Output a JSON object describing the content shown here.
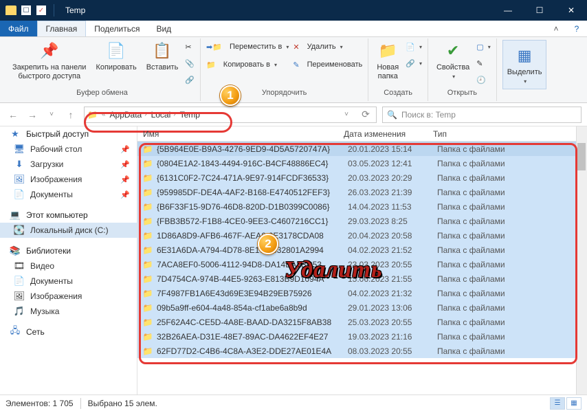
{
  "titlebar": {
    "title": "Temp"
  },
  "menu": {
    "file": "Файл",
    "main": "Главная",
    "share": "Поделиться",
    "view": "Вид"
  },
  "ribbon": {
    "pin": "Закрепить на панели\nбыстрого доступа",
    "copy": "Копировать",
    "paste": "Вставить",
    "clip_group": "Буфер обмена",
    "move": "Переместить в",
    "copy_to": "Копировать в",
    "delete": "Удалить",
    "rename": "Переименовать",
    "org_group": "Упорядочить",
    "new_folder": "Новая\nпапка",
    "create_group": "Создать",
    "props": "Свойства",
    "open_group": "Открыть",
    "select": "Выделить"
  },
  "addr": {
    "crumbs": [
      "AppData",
      "Local",
      "Temp"
    ],
    "search_ph": "Поиск в: Temp"
  },
  "sidebar": {
    "quick": "Быстрый доступ",
    "desktop": "Рабочий стол",
    "downloads": "Загрузки",
    "pictures": "Изображения",
    "documents": "Документы",
    "this_pc": "Этот компьютер",
    "local_c": "Локальный диск (C:)",
    "libraries": "Библиотеки",
    "videos": "Видео",
    "documents2": "Документы",
    "pictures2": "Изображения",
    "music": "Музыка",
    "network": "Сеть"
  },
  "cols": {
    "name": "Имя",
    "date": "Дата изменения",
    "type": "Тип"
  },
  "type_str": "Папка с файлами",
  "files": [
    {
      "n": "{5B964E0E-B9A3-4276-9ED9-4D5A5720747A}",
      "d": "20.01.2023 15:14"
    },
    {
      "n": "{0804E1A2-1843-4494-916C-B4CF48886EC4}",
      "d": "03.05.2023 12:41"
    },
    {
      "n": "{6131C0F2-7C24-471A-9E97-914FCDF36533}",
      "d": "20.03.2023 20:29"
    },
    {
      "n": "{959985DF-DE4A-4AF2-B168-E4740512FEF3}",
      "d": "26.03.2023 21:39"
    },
    {
      "n": "{B6F33F15-9D76-46D8-820D-D1B0399C0086}",
      "d": "14.04.2023 11:53"
    },
    {
      "n": "{FBB3B572-F1B8-4CE0-9EE3-C4607216CC1}",
      "d": "29.03.2023 8:25"
    },
    {
      "n": "1D86A8D9-AFB6-467F-AEA6-2E3178CDA08",
      "d": "20.04.2023 20:58"
    },
    {
      "n": "6E31A6DA-A794-4D78-8E17-A032801A2994",
      "d": "04.02.2023 21:52"
    },
    {
      "n": "7ACA8EF0-5006-4112-94D8-DA14BA1BC53",
      "d": "23.03.2023 20:55"
    },
    {
      "n": "7D4754CA-974B-44E5-9263-E813B9D1094A",
      "d": "15.06.2023 21:55"
    },
    {
      "n": "7F4987FB1A6E43d69E3E94B29EB75926",
      "d": "04.02.2023 21:32"
    },
    {
      "n": "09b5a9ff-e604-4a48-854a-cf1abe6a8b9d",
      "d": "29.01.2023 13:06"
    },
    {
      "n": "25F62A4C-CE5D-4A8E-BAAD-DA3215F8AB38",
      "d": "25.03.2023 20:55"
    },
    {
      "n": "32B26AEA-D31E-48E7-89AC-DA4622EF4E27",
      "d": "19.03.2023 21:16"
    },
    {
      "n": "62FD77D2-C4B6-4C8A-A3E2-DDE27AE01E4A",
      "d": "08.03.2023 20:55"
    }
  ],
  "status": {
    "elements": "Элементов: 1 705",
    "selected": "Выбрано 15 элем."
  },
  "overlay": {
    "delete": "Удалить"
  }
}
